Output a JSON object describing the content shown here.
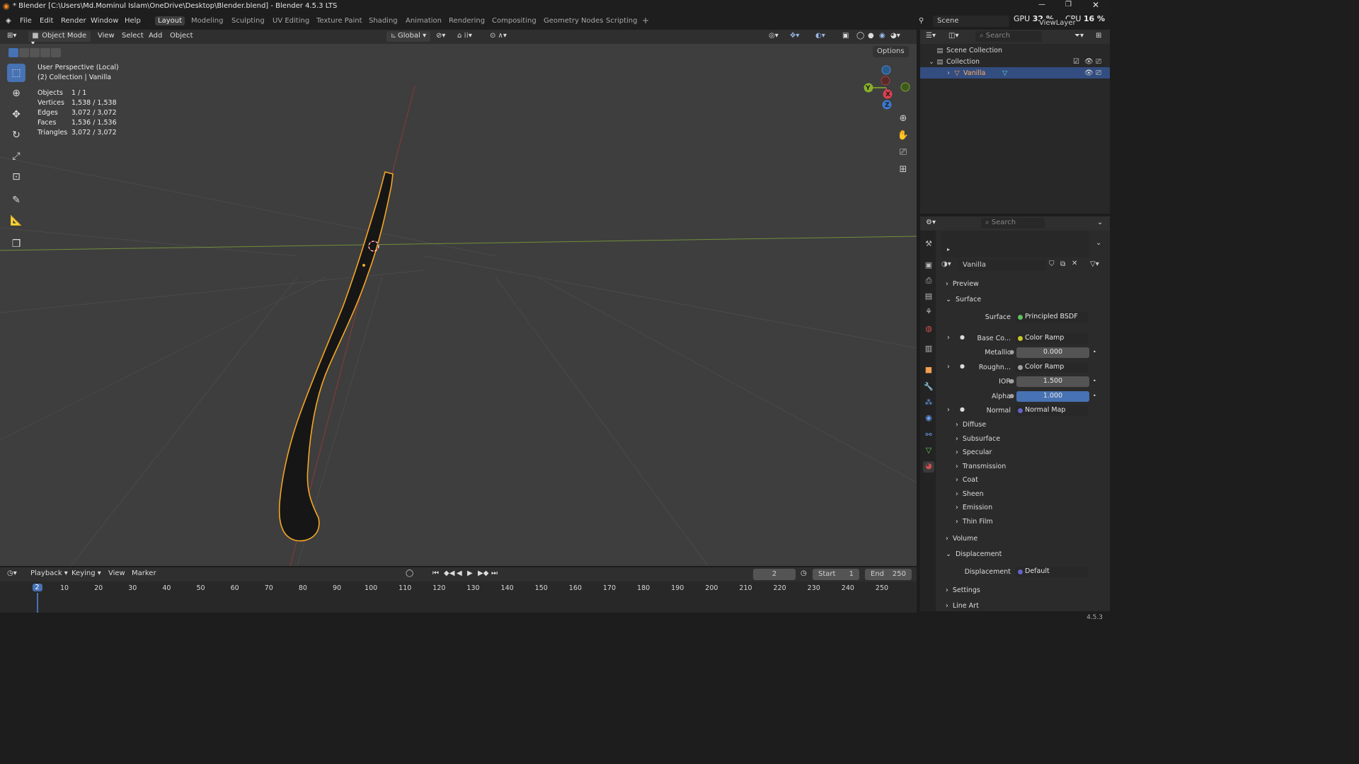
{
  "window": {
    "title": "* Blender [C:\\Users\\Md.Mominul Islam\\OneDrive\\Desktop\\Blender.blend] - Blender 4.5.3 LTS",
    "gpu_label": "GPU",
    "gpu_value": "32 %",
    "cpu_label": "CPU",
    "cpu_value": "16 %"
  },
  "menu": [
    "File",
    "Edit",
    "Render",
    "Window",
    "Help"
  ],
  "workspaces": [
    "Layout",
    "Modeling",
    "Sculpting",
    "UV Editing",
    "Texture Paint",
    "Shading",
    "Animation",
    "Rendering",
    "Compositing",
    "Geometry Nodes",
    "Scripting"
  ],
  "scene": {
    "name": "Scene",
    "view_layer": "ViewLayer"
  },
  "viewport_header": {
    "mode": "Object Mode",
    "menus": [
      "View",
      "Select",
      "Add",
      "Object"
    ],
    "orientation": "Global",
    "options": "Options"
  },
  "viewport": {
    "perspective": "User Perspective (Local)",
    "collection": "(2) Collection | Vanilla",
    "stats": [
      {
        "label": "Objects",
        "value": "1 / 1"
      },
      {
        "label": "Vertices",
        "value": "1,538 / 1,538"
      },
      {
        "label": "Edges",
        "value": "3,072 / 3,072"
      },
      {
        "label": "Faces",
        "value": "1,536 / 1,536"
      },
      {
        "label": "Triangles",
        "value": "3,072 / 3,072"
      }
    ],
    "gizmo": {
      "x": "X",
      "y": "Y",
      "z": "Z"
    }
  },
  "outliner": {
    "search_placeholder": "Search",
    "items": [
      {
        "label": "Scene Collection"
      },
      {
        "label": "Collection"
      },
      {
        "label": "Vanilla"
      }
    ]
  },
  "properties": {
    "search_placeholder": "Search",
    "material_name": "Vanilla",
    "panels": {
      "preview": "Preview",
      "surface": "Surface",
      "volume": "Volume",
      "displacement": "Displacement",
      "settings": "Settings",
      "line_art": "Line Art"
    },
    "fields": [
      {
        "label": "Surface",
        "value": "Principled BSDF",
        "dot": "#5fbf5f"
      },
      {
        "label": "Base Co...",
        "value": "Color Ramp",
        "dot": "#c7c729"
      },
      {
        "label": "Metallic",
        "value": "0.000",
        "dot": "#a1a1a1"
      },
      {
        "label": "Roughn...",
        "value": "Color Ramp",
        "dot": "#a1a1a1"
      },
      {
        "label": "IOR",
        "value": "1.500",
        "dot": "#a1a1a1"
      },
      {
        "label": "Alpha",
        "value": "1.000",
        "dot": "#a1a1a1"
      },
      {
        "label": "Normal",
        "value": "Normal Map",
        "dot": "#6363c7"
      }
    ],
    "subpanels": [
      "Diffuse",
      "Subsurface",
      "Specular",
      "Transmission",
      "Coat",
      "Sheen",
      "Emission",
      "Thin Film"
    ],
    "displacement_field": {
      "label": "Displacement",
      "value": "Default",
      "dot": "#6363c7"
    }
  },
  "timeline": {
    "menus": [
      "Playback",
      "Keying",
      "View",
      "Marker"
    ],
    "current_frame": "2",
    "start_label": "Start",
    "start": "1",
    "end_label": "End",
    "end": "250",
    "ticks": [
      "2",
      "10",
      "20",
      "30",
      "40",
      "50",
      "60",
      "70",
      "80",
      "90",
      "100",
      "110",
      "120",
      "130",
      "140",
      "150",
      "160",
      "170",
      "180",
      "190",
      "200",
      "210",
      "220",
      "230",
      "240",
      "250"
    ]
  },
  "status": {
    "version": "4.5.3"
  },
  "colors": {
    "accent": "#4772b3",
    "selection": "#f5a623",
    "header": "#2f2f2f",
    "viewport": "#3e3e3e"
  }
}
